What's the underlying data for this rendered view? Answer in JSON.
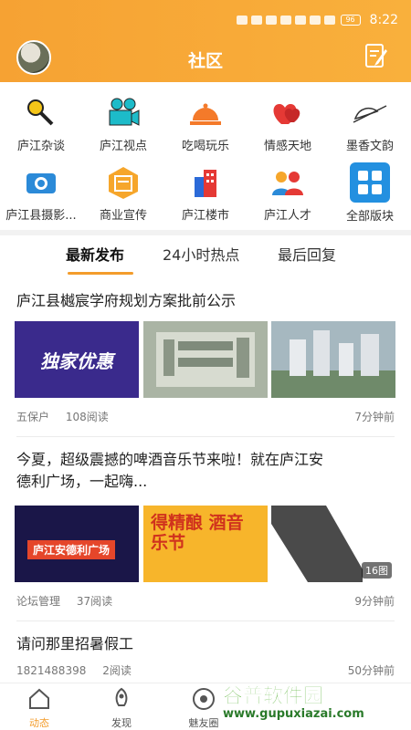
{
  "status": {
    "time": "8:22",
    "battery": "96"
  },
  "header": {
    "title": "社区"
  },
  "categories": [
    {
      "label": "庐江杂谈",
      "icon": "microphone-icon"
    },
    {
      "label": "庐江视点",
      "icon": "video-camera-icon"
    },
    {
      "label": "吃喝玩乐",
      "icon": "food-tray-icon"
    },
    {
      "label": "情感天地",
      "icon": "hearts-icon"
    },
    {
      "label": "墨香文韵",
      "icon": "quill-icon"
    },
    {
      "label": "庐江县摄影...",
      "icon": "camera-icon"
    },
    {
      "label": "商业宣传",
      "icon": "business-icon"
    },
    {
      "label": "庐江楼市",
      "icon": "building-icon"
    },
    {
      "label": "庐江人才",
      "icon": "people-icon"
    },
    {
      "label": "全部版块",
      "icon": "grid-icon"
    }
  ],
  "tabs": [
    {
      "label": "最新发布"
    },
    {
      "label": "24小时热点"
    },
    {
      "label": "最后回复"
    }
  ],
  "posts": [
    {
      "title": "庐江县樾宸学府规划方案批前公示",
      "images": [
        "独家优惠",
        "",
        ""
      ],
      "author": "五保户",
      "reads": "108阅读",
      "time": "7分钟前"
    },
    {
      "title_line1": "今夏，超级震撼的啤酒音乐节来啦！就在庐江安",
      "title_line2": "德利广场，一起嗨...",
      "images": [
        "庐江安德利广场",
        "得精酿 酒音乐节",
        ""
      ],
      "image_count": "16图",
      "author": "论坛管理",
      "reads": "37阅读",
      "time": "9分钟前"
    },
    {
      "title": "请问那里招暑假工",
      "author": "1821488398",
      "reads": "2阅读",
      "time": "50分钟前"
    }
  ],
  "bottom_nav": [
    {
      "label": "动态",
      "icon": "home-icon"
    },
    {
      "label": "发现",
      "icon": "rocket-icon"
    },
    {
      "label": "魅友圈",
      "icon": "eye-circle-icon"
    }
  ],
  "watermark": {
    "brand": "谷普软件园",
    "url": "www.gupuxiazai.com"
  },
  "colors": {
    "accent": "#f39c2b",
    "header": "#f6a233"
  }
}
